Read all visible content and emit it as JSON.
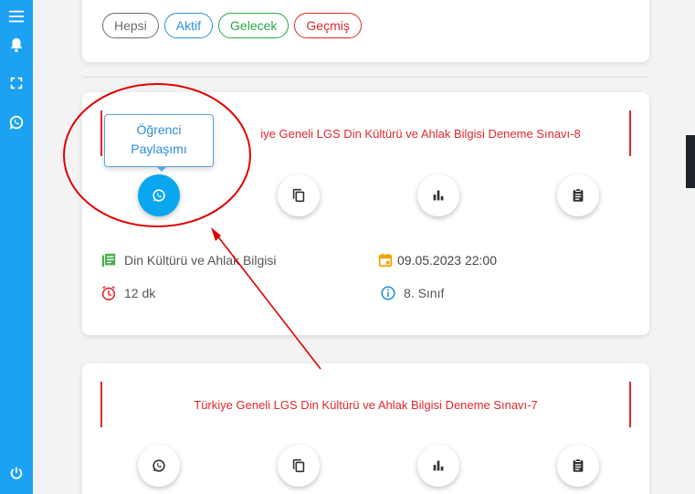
{
  "sidebar": {
    "icons": [
      "menu-icon",
      "bell-icon",
      "fullscreen-icon",
      "whatsapp-icon",
      "power-icon"
    ]
  },
  "filters": [
    {
      "label": "Hepsi",
      "color": "#6c6c6c"
    },
    {
      "label": "Aktif",
      "color": "#2d8fdc"
    },
    {
      "label": "Gelecek",
      "color": "#28a745"
    },
    {
      "label": "Geçmiş",
      "color": "#e0282e"
    }
  ],
  "exams": [
    {
      "title": "Türkiye Geneli LGS Din Kültürü ve Ahlak Bilgisi Deneme Sınavı-8",
      "title_visible": "iye Geneli LGS Din Kültürü ve Ahlak Bilgisi Deneme Sınavı-8",
      "subject": "Din Kültürü ve Ahlak Bilgisi",
      "date": "09.05.2023 22:00",
      "duration": "12 dk",
      "grade": "8. Sınıf",
      "tooltip": {
        "line1": "Öğrenci",
        "line2": "Paylaşımı"
      }
    },
    {
      "title": "Türkiye Geneli LGS Din Kültürü ve Ahlak Bilgisi Deneme Sınavı-7"
    }
  ],
  "actions": [
    "whatsapp-icon",
    "copy-icon",
    "bar-chart-icon",
    "clipboard-icon"
  ],
  "colors": {
    "sidebar": "#1da1f2",
    "primary_button": "#0aa7f0",
    "title_red": "#e0282e",
    "annotation_red": "#e00000",
    "subject_icon": "#4caf50",
    "date_icon": "#f0a500",
    "duration_icon": "#e0282e",
    "grade_icon": "#2d8fdc"
  }
}
